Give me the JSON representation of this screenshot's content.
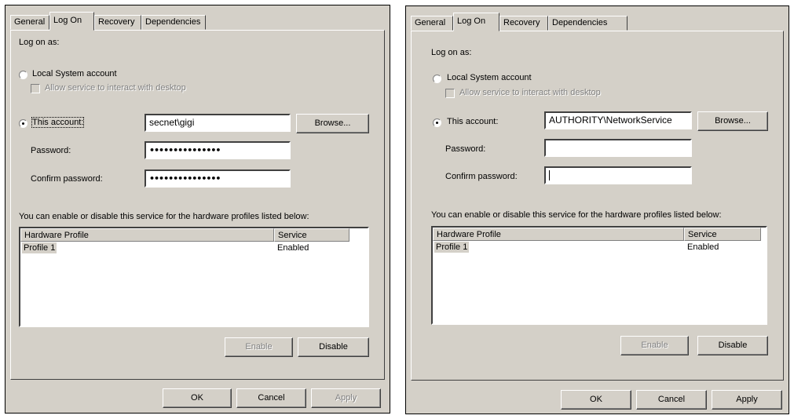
{
  "dialogs": [
    {
      "tabs": [
        "General",
        "Log On",
        "Recovery",
        "Dependencies"
      ],
      "active_tab": "Log On",
      "logon_as_label": "Log on as:",
      "local_system_label": "Local System account",
      "allow_interact_label": "Allow service to interact with desktop",
      "this_account_label": "This account:",
      "account_value": "secnet\\gigi",
      "browse_label": "Browse...",
      "password_label": "Password:",
      "password_value": "•••••••••••••••",
      "confirm_label": "Confirm password:",
      "confirm_value": "•••••••••••••••",
      "profiles_text": "You can enable or disable this service for the hardware profiles listed below:",
      "col_profile": "Hardware Profile",
      "col_service": "Service",
      "row_profile": "Profile 1",
      "row_service": "Enabled",
      "enable_label": "Enable",
      "disable_label": "Disable",
      "ok_label": "OK",
      "cancel_label": "Cancel",
      "apply_label": "Apply",
      "apply_enabled": false
    },
    {
      "tabs": [
        "General",
        "Log On",
        "Recovery",
        "Dependencies"
      ],
      "active_tab": "Log On",
      "logon_as_label": "Log on as:",
      "local_system_label": "Local System account",
      "allow_interact_label": "Allow service to interact with desktop",
      "this_account_label": "This account:",
      "account_value": "AUTHORITY\\NetworkService",
      "browse_label": "Browse...",
      "password_label": "Password:",
      "password_value": "",
      "confirm_label": "Confirm password:",
      "confirm_value": "",
      "profiles_text": "You can enable or disable this service for the hardware profiles listed below:",
      "col_profile": "Hardware Profile",
      "col_service": "Service",
      "row_profile": "Profile 1",
      "row_service": "Enabled",
      "enable_label": "Enable",
      "disable_label": "Disable",
      "ok_label": "OK",
      "cancel_label": "Cancel",
      "apply_label": "Apply",
      "apply_enabled": true
    }
  ]
}
